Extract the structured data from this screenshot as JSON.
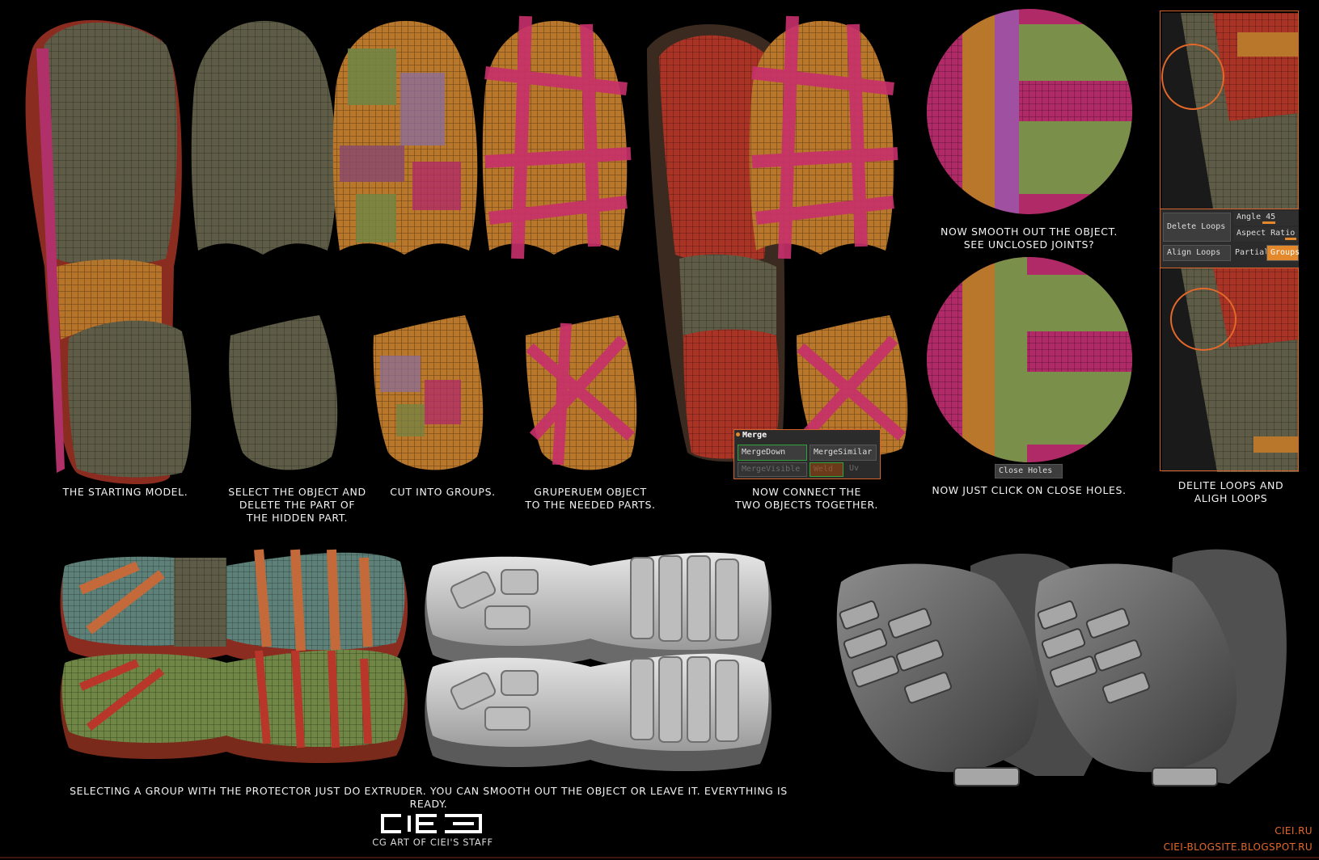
{
  "captions": {
    "step1": "THE STARTING MODEL.",
    "step2": "SELECT THE OBJECT AND\nDELETE THE PART OF\nTHE HIDDEN PART.",
    "step3": "CUT INTO GROUPS.",
    "step4": "GRUPERUEM OBJECT\nTO THE NEEDED PARTS.",
    "step5": "NOW CONNECT THE\nTWO OBJECTS TOGETHER.",
    "step6a": "NOW SMOOTH OUT THE OBJECT.\nSEE UNCLOSED JOINTS?",
    "step6b": "NOW JUST CLICK ON CLOSE HOLES.",
    "step7": "DELITE LOOPS AND\nALIGH LOOPS",
    "bottom": "SELECTING A GROUP WITH THE PROTECTOR JUST DO EXTRUDER.  YOU CAN SMOOTH OUT THE OBJECT OR LEAVE IT.  EVERYTHING IS READY."
  },
  "merge_panel": {
    "title": "Merge",
    "merge_down": "MergeDown",
    "merge_similar": "MergeSimilar",
    "merge_visible": "MergeVisible",
    "weld": "Weld",
    "uv": "Uv"
  },
  "close_holes": "Close Holes",
  "loops_panel": {
    "delete_loops": "Delete Loops",
    "angle_label": "Angle 45",
    "aspect_ratio": "Aspect Ratio",
    "align_loops": "Align Loops",
    "partial": "Partial",
    "groups": "Groups"
  },
  "footer": {
    "logo_text": "CIEI",
    "logo_sub": "CG ART OF CIEI'S STAFF",
    "site1": "CIEI.RU",
    "site2": "CIEI-BLOGSITE.BLOGSPOT.RU"
  },
  "colors": {
    "accent": "#d4622a",
    "olive": "#5f5f45",
    "magenta": "#b5296a",
    "orange": "#c97a2a",
    "red": "#b33a2a",
    "green": "#7a8f4a",
    "clay": "#8a8a8a"
  }
}
